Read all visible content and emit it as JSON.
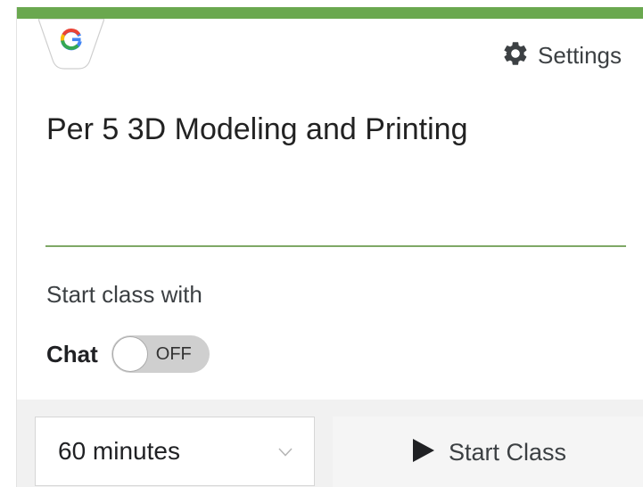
{
  "provider": {
    "icon": "google-g-icon",
    "letter": "G",
    "brand_colors": {
      "blue": "#4285F4",
      "red": "#EA4335",
      "yellow": "#FBBC05",
      "green": "#34A853"
    }
  },
  "header": {
    "settings_icon": "gear-icon",
    "settings_label": "Settings"
  },
  "class_name": "Per 5 3D Modeling and Printing",
  "start_options": {
    "heading": "Start class with",
    "chat_label": "Chat",
    "chat_toggle_state": "OFF"
  },
  "footer": {
    "duration_value": "60 minutes",
    "duration_chevron_icon": "chevron-down-icon",
    "start_icon": "play-icon",
    "start_label": "Start Class"
  },
  "colors": {
    "accent_bar": "#6aa84f",
    "divider": "#7fa866",
    "toggle_off": "#cfcfcf",
    "footer_bg": "#f1f1f1"
  }
}
